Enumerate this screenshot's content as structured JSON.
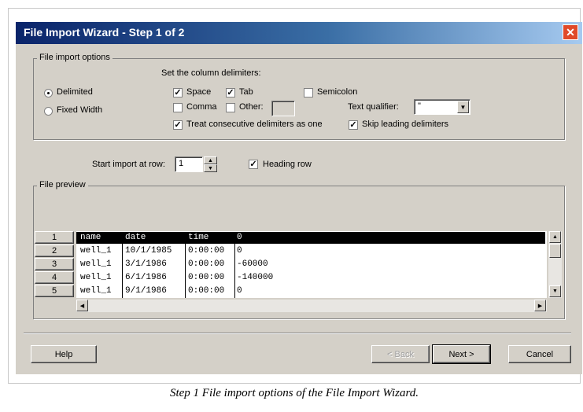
{
  "window": {
    "title": "File Import Wizard - Step 1 of 2"
  },
  "options": {
    "group_label": "File import options",
    "delimiters_heading": "Set the column delimiters:",
    "radio_delimited": "Delimited",
    "radio_fixed_width": "Fixed Width",
    "space": "Space",
    "tab": "Tab",
    "semicolon": "Semicolon",
    "comma": "Comma",
    "other": "Other:",
    "text_qualifier_label": "Text qualifier:",
    "text_qualifier_value": "\"",
    "treat_consecutive": "Treat consecutive delimiters as one",
    "skip_leading": "Skip leading delimiters"
  },
  "start": {
    "label": "Start import at row:",
    "value": "1",
    "heading_row": "Heading row"
  },
  "preview": {
    "label": "File preview",
    "row_numbers": [
      "1",
      "2",
      "3",
      "4",
      "5"
    ],
    "rows": [
      [
        "name",
        "date",
        "time",
        "0"
      ],
      [
        "well_1",
        "10/1/1985",
        "0:00:00",
        "0"
      ],
      [
        "well_1",
        "3/1/1986",
        "0:00:00",
        "-60000"
      ],
      [
        "well_1",
        "6/1/1986",
        "0:00:00",
        "-140000"
      ],
      [
        "well_1",
        "9/1/1986",
        "0:00:00",
        "0"
      ]
    ]
  },
  "buttons": {
    "help": "Help",
    "back": "< Back",
    "next": "Next >",
    "cancel": "Cancel"
  },
  "caption": "Step 1 File import options of the File Import Wizard."
}
